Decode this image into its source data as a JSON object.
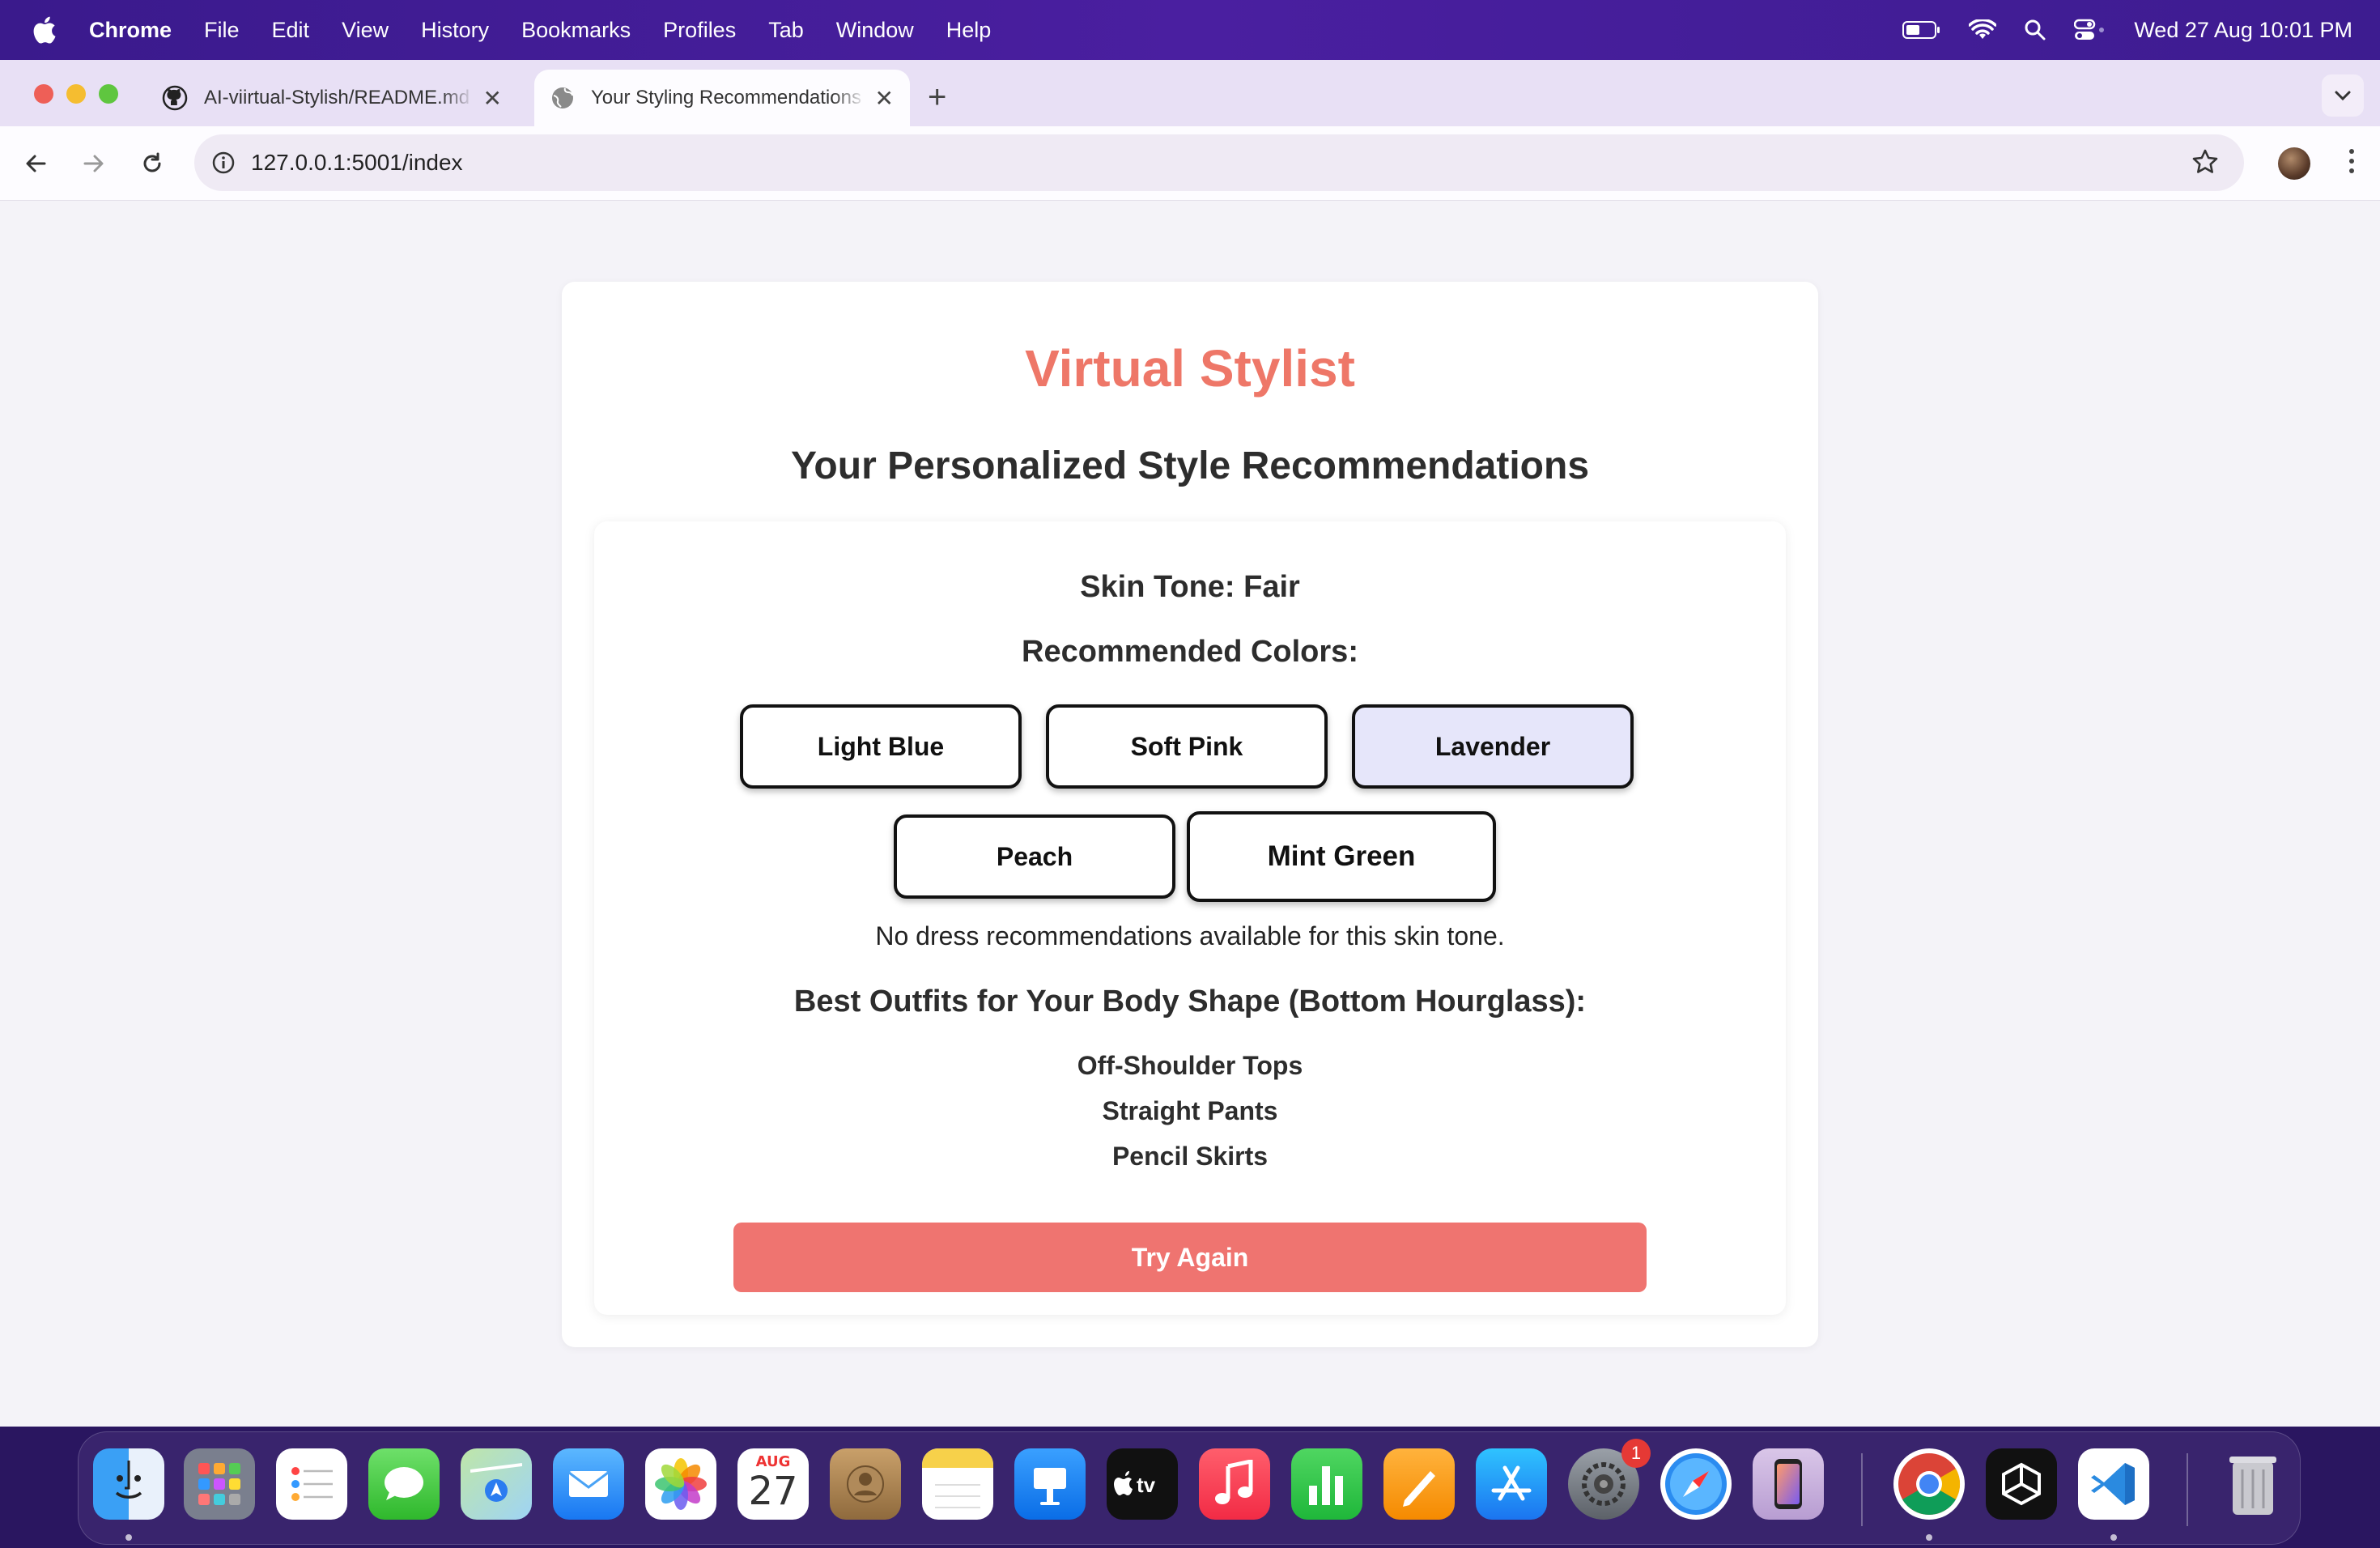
{
  "menubar": {
    "app_name": "Chrome",
    "items": [
      "File",
      "Edit",
      "View",
      "History",
      "Bookmarks",
      "Profiles",
      "Tab",
      "Window",
      "Help"
    ],
    "datetime": "Wed 27 Aug  10:01 PM"
  },
  "browser": {
    "tabs": [
      {
        "title": "AI-viirtual-Stylish/README.md",
        "icon": "github-icon",
        "active": false
      },
      {
        "title": "Your Styling Recommendations",
        "icon": "globe-icon",
        "active": true
      }
    ],
    "url": "127.0.0.1:5001/index"
  },
  "page": {
    "title": "Virtual Stylist",
    "subtitle": "Your Personalized Style Recommendations",
    "skin_tone": "Skin Tone: Fair",
    "colors_heading": "Recommended Colors:",
    "colors": [
      {
        "label": "Light Blue",
        "bg": "#ffffff"
      },
      {
        "label": "Soft Pink",
        "bg": "#ffffff"
      },
      {
        "label": "Lavender",
        "bg": "#e6e6fa"
      },
      {
        "label": "Peach",
        "bg": "#ffffff"
      },
      {
        "label": "Mint Green",
        "bg": "#ffffff"
      }
    ],
    "no_dress": "No dress recommendations available for this skin tone.",
    "body_heading": "Best Outfits for Your Body Shape (Bottom Hourglass):",
    "outfits": [
      "Off-Shoulder Tops",
      "Straight Pants",
      "Pencil Skirts"
    ],
    "try_again": "Try Again",
    "accent_color": "#ee7768",
    "button_color": "#ef7470"
  },
  "dock": {
    "calendar_month": "AUG",
    "calendar_day": "27",
    "settings_badge": "1",
    "apps": [
      "finder-icon",
      "launchpad-icon",
      "reminders-icon",
      "messages-icon",
      "maps-icon",
      "mail-icon",
      "photos-icon",
      "calendar-icon",
      "contacts-icon",
      "notes-icon",
      "keynote-icon",
      "appletv-icon",
      "music-icon",
      "numbers-icon",
      "pages-icon",
      "appstore-icon",
      "system-settings-icon",
      "safari-icon",
      "iphone-mirroring-icon",
      "chrome-icon",
      "unity-icon",
      "vscode-icon",
      "trash-icon"
    ]
  }
}
